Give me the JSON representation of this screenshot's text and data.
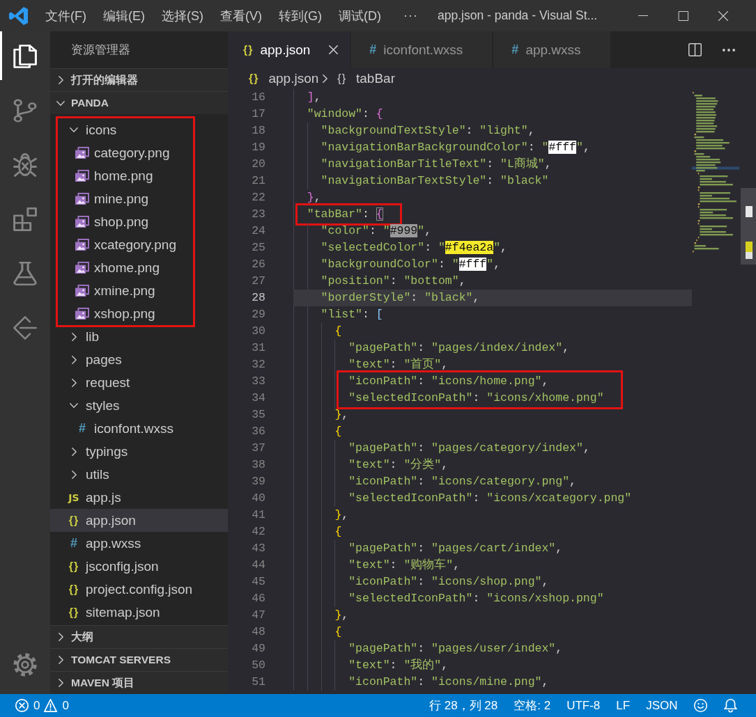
{
  "title_bar": {
    "menus": [
      "文件(F)",
      "编辑(E)",
      "选择(S)",
      "查看(V)",
      "转到(G)",
      "调试(D)"
    ],
    "overflow": "···",
    "title": "app.json - panda - Visual St..."
  },
  "activity_bar": {
    "items": [
      {
        "kind": "files",
        "selected": true
      },
      {
        "kind": "source-control",
        "selected": false
      },
      {
        "kind": "debug",
        "selected": false
      },
      {
        "kind": "extensions",
        "selected": false
      },
      {
        "kind": "testing",
        "selected": false
      },
      {
        "kind": "diamond",
        "selected": false
      }
    ]
  },
  "sidebar": {
    "title": "资源管理器",
    "sections": [
      {
        "label": "打开的编辑器",
        "expanded": false
      },
      {
        "label": "PANDA",
        "expanded": true,
        "tree": [
          {
            "kind": "folder",
            "label": "icons",
            "expanded": true,
            "selected": false,
            "marked": true,
            "children": [
              {
                "kind": "image",
                "label": "category.png",
                "selected": false
              },
              {
                "kind": "image",
                "label": "home.png",
                "selected": false
              },
              {
                "kind": "image",
                "label": "mine.png",
                "selected": false
              },
              {
                "kind": "image",
                "label": "shop.png",
                "selected": false
              },
              {
                "kind": "image",
                "label": "xcategory.png",
                "selected": false
              },
              {
                "kind": "image",
                "label": "xhome.png",
                "selected": false
              },
              {
                "kind": "image",
                "label": "xmine.png",
                "selected": false
              },
              {
                "kind": "image",
                "label": "xshop.png",
                "selected": false
              }
            ]
          },
          {
            "kind": "folder",
            "label": "lib",
            "expanded": false,
            "selected": false,
            "marked": false
          },
          {
            "kind": "folder",
            "label": "pages",
            "expanded": false,
            "selected": false,
            "marked": false
          },
          {
            "kind": "folder",
            "label": "request",
            "expanded": false,
            "selected": false,
            "marked": false
          },
          {
            "kind": "folder",
            "label": "styles",
            "expanded": true,
            "selected": false,
            "marked": false,
            "children": [
              {
                "kind": "css",
                "icon": "#",
                "label": "iconfont.wxss",
                "selected": false
              }
            ]
          },
          {
            "kind": "folder",
            "label": "typings",
            "expanded": false,
            "selected": false,
            "marked": false
          },
          {
            "kind": "folder",
            "label": "utils",
            "expanded": false,
            "selected": false,
            "marked": false
          },
          {
            "kind": "js",
            "icon": "JS",
            "label": "app.js",
            "selected": false,
            "marked": false
          },
          {
            "kind": "json",
            "icon": "{}",
            "label": "app.json",
            "selected": true,
            "marked": false
          },
          {
            "kind": "css",
            "icon": "#",
            "label": "app.wxss",
            "selected": false,
            "marked": false
          },
          {
            "kind": "json",
            "icon": "{}",
            "label": "jsconfig.json",
            "selected": false,
            "marked": false
          },
          {
            "kind": "json",
            "icon": "{}",
            "label": "project.config.json",
            "selected": false,
            "marked": false
          },
          {
            "kind": "json",
            "icon": "{}",
            "label": "sitemap.json",
            "selected": false,
            "marked": false
          }
        ]
      },
      {
        "label": "大纲",
        "expanded": false
      },
      {
        "label": "TOMCAT SERVERS",
        "expanded": false
      },
      {
        "label": "MAVEN 项目",
        "expanded": false
      }
    ]
  },
  "editor": {
    "tabs": [
      {
        "kind": "json",
        "icon": "{}",
        "label": "app.json",
        "selected": true
      },
      {
        "kind": "css",
        "icon": "#",
        "label": "iconfont.wxss",
        "selected": false
      },
      {
        "kind": "css",
        "icon": "#",
        "label": "app.wxss",
        "selected": false
      }
    ],
    "breadcrumb": [
      {
        "kind": "json",
        "icon": "{}",
        "label": "app.json"
      },
      {
        "kind": "object",
        "icon": "{}",
        "label": "tabBar"
      }
    ],
    "lines": [
      {
        "number": "16",
        "current": false,
        "marked": false,
        "tokens": [
          {
            "kind": "bracket",
            "text": "]",
            "color": "#da70d6"
          },
          {
            "kind": "punct",
            "text": ","
          }
        ]
      },
      {
        "number": "17",
        "current": false,
        "marked": false,
        "tokens": [
          {
            "kind": "str",
            "text": "\"window\""
          },
          {
            "kind": "punct",
            "text": ": "
          },
          {
            "kind": "bracket",
            "text": "{",
            "color": "#da70d6"
          }
        ],
        "children": [
          {
            "number": "18",
            "current": false,
            "marked": false,
            "tokens": [
              {
                "kind": "str",
                "text": "\"backgroundTextStyle\""
              },
              {
                "kind": "punct",
                "text": ": "
              },
              {
                "kind": "str",
                "text": "\"light\""
              },
              {
                "kind": "punct",
                "text": ","
              }
            ]
          },
          {
            "number": "19",
            "current": false,
            "marked": false,
            "tokens": [
              {
                "kind": "str",
                "text": "\"navigationBarBackgroundColor\""
              },
              {
                "kind": "punct",
                "text": ": "
              },
              {
                "kind": "str",
                "text": "\""
              },
              {
                "kind": "swatch",
                "text": "#fff",
                "color": "#ffffff"
              },
              {
                "kind": "str",
                "text": "\""
              },
              {
                "kind": "punct",
                "text": ","
              }
            ]
          },
          {
            "number": "20",
            "current": false,
            "marked": false,
            "tokens": [
              {
                "kind": "str",
                "text": "\"navigationBarTitleText\""
              },
              {
                "kind": "punct",
                "text": ": "
              },
              {
                "kind": "str",
                "text": "\"L商城\""
              },
              {
                "kind": "punct",
                "text": ","
              }
            ]
          },
          {
            "number": "21",
            "current": false,
            "marked": false,
            "tokens": [
              {
                "kind": "str",
                "text": "\"navigationBarTextStyle\""
              },
              {
                "kind": "punct",
                "text": ": "
              },
              {
                "kind": "str",
                "text": "\"black\""
              }
            ]
          }
        ]
      },
      {
        "number": "22",
        "current": false,
        "marked": false,
        "tokens": [
          {
            "kind": "bracket",
            "text": "}",
            "color": "#da70d6"
          },
          {
            "kind": "punct",
            "text": ","
          }
        ]
      },
      {
        "number": "23",
        "current": false,
        "marked": true,
        "tokens": [
          {
            "kind": "str",
            "text": "\"tabBar\""
          },
          {
            "kind": "punct",
            "text": ": "
          },
          {
            "kind": "matched-bracket",
            "text": "{",
            "color": "#da70d6"
          }
        ],
        "children": [
          {
            "number": "24",
            "current": false,
            "marked": false,
            "tokens": [
              {
                "kind": "str",
                "text": "\"color\""
              },
              {
                "kind": "punct",
                "text": ": "
              },
              {
                "kind": "str",
                "text": "\""
              },
              {
                "kind": "swatch",
                "text": "#999",
                "color": "#999999"
              },
              {
                "kind": "str",
                "text": "\""
              },
              {
                "kind": "punct",
                "text": ","
              }
            ]
          },
          {
            "number": "25",
            "current": false,
            "marked": false,
            "tokens": [
              {
                "kind": "str",
                "text": "\"selectedColor\""
              },
              {
                "kind": "punct",
                "text": ": "
              },
              {
                "kind": "str",
                "text": "\""
              },
              {
                "kind": "swatch",
                "text": "#f4ea2a",
                "color": "#f4ea2a"
              },
              {
                "kind": "str",
                "text": "\""
              },
              {
                "kind": "punct",
                "text": ","
              }
            ]
          },
          {
            "number": "26",
            "current": false,
            "marked": false,
            "tokens": [
              {
                "kind": "str",
                "text": "\"backgroundColor\""
              },
              {
                "kind": "punct",
                "text": ": "
              },
              {
                "kind": "str",
                "text": "\""
              },
              {
                "kind": "swatch",
                "text": "#fff",
                "color": "#ffffff"
              },
              {
                "kind": "str",
                "text": "\""
              },
              {
                "kind": "punct",
                "text": ","
              }
            ]
          },
          {
            "number": "27",
            "current": false,
            "marked": false,
            "tokens": [
              {
                "kind": "str",
                "text": "\"position\""
              },
              {
                "kind": "punct",
                "text": ": "
              },
              {
                "kind": "str",
                "text": "\"bottom\""
              },
              {
                "kind": "punct",
                "text": ","
              }
            ]
          },
          {
            "number": "28",
            "current": true,
            "marked": false,
            "tokens": [
              {
                "kind": "str",
                "text": "\"borderStyle\""
              },
              {
                "kind": "punct",
                "text": ": "
              },
              {
                "kind": "str",
                "text": "\"black\""
              },
              {
                "kind": "punct",
                "text": ","
              }
            ]
          },
          {
            "number": "29",
            "current": false,
            "marked": false,
            "tokens": [
              {
                "kind": "str",
                "text": "\"list\""
              },
              {
                "kind": "punct",
                "text": ": "
              },
              {
                "kind": "bracket",
                "text": "[",
                "color": "#87cefa"
              }
            ],
            "children": [
              {
                "number": "30",
                "current": false,
                "marked": false,
                "tokens": [
                  {
                    "kind": "bracket",
                    "text": "{",
                    "color": "#ffd700"
                  }
                ],
                "children": [
                  {
                    "number": "31",
                    "current": false,
                    "marked": false,
                    "tokens": [
                      {
                        "kind": "str",
                        "text": "\"pagePath\""
                      },
                      {
                        "kind": "punct",
                        "text": ": "
                      },
                      {
                        "kind": "str",
                        "text": "\"pages/index/index\""
                      },
                      {
                        "kind": "punct",
                        "text": ","
                      }
                    ]
                  },
                  {
                    "number": "32",
                    "current": false,
                    "marked": false,
                    "tokens": [
                      {
                        "kind": "str",
                        "text": "\"text\""
                      },
                      {
                        "kind": "punct",
                        "text": ": "
                      },
                      {
                        "kind": "str",
                        "text": "\"首页\""
                      },
                      {
                        "kind": "punct",
                        "text": ","
                      }
                    ]
                  },
                  {
                    "number": "33",
                    "current": false,
                    "marked": true,
                    "tokens": [
                      {
                        "kind": "str",
                        "text": "\"iconPath\""
                      },
                      {
                        "kind": "punct",
                        "text": ": "
                      },
                      {
                        "kind": "str",
                        "text": "\"icons/home.png\""
                      },
                      {
                        "kind": "punct",
                        "text": ","
                      }
                    ]
                  },
                  {
                    "number": "34",
                    "current": false,
                    "marked": true,
                    "tokens": [
                      {
                        "kind": "str",
                        "text": "\"selectedIconPath\""
                      },
                      {
                        "kind": "punct",
                        "text": ": "
                      },
                      {
                        "kind": "str",
                        "text": "\"icons/xhome.png\""
                      }
                    ]
                  }
                ]
              },
              {
                "number": "35",
                "current": false,
                "marked": false,
                "tokens": [
                  {
                    "kind": "bracket",
                    "text": "}",
                    "color": "#ffd700"
                  },
                  {
                    "kind": "punct",
                    "text": ","
                  }
                ]
              },
              {
                "number": "36",
                "current": false,
                "marked": false,
                "tokens": [
                  {
                    "kind": "bracket",
                    "text": "{",
                    "color": "#ffd700"
                  }
                ],
                "children": [
                  {
                    "number": "37",
                    "current": false,
                    "marked": false,
                    "tokens": [
                      {
                        "kind": "str",
                        "text": "\"pagePath\""
                      },
                      {
                        "kind": "punct",
                        "text": ": "
                      },
                      {
                        "kind": "str",
                        "text": "\"pages/category/index\""
                      },
                      {
                        "kind": "punct",
                        "text": ","
                      }
                    ]
                  },
                  {
                    "number": "38",
                    "current": false,
                    "marked": false,
                    "tokens": [
                      {
                        "kind": "str",
                        "text": "\"text\""
                      },
                      {
                        "kind": "punct",
                        "text": ": "
                      },
                      {
                        "kind": "str",
                        "text": "\"分类\""
                      },
                      {
                        "kind": "punct",
                        "text": ","
                      }
                    ]
                  },
                  {
                    "number": "39",
                    "current": false,
                    "marked": false,
                    "tokens": [
                      {
                        "kind": "str",
                        "text": "\"iconPath\""
                      },
                      {
                        "kind": "punct",
                        "text": ": "
                      },
                      {
                        "kind": "str",
                        "text": "\"icons/category.png\""
                      },
                      {
                        "kind": "punct",
                        "text": ","
                      }
                    ]
                  },
                  {
                    "number": "40",
                    "current": false,
                    "marked": false,
                    "tokens": [
                      {
                        "kind": "str",
                        "text": "\"selectedIconPath\""
                      },
                      {
                        "kind": "punct",
                        "text": ": "
                      },
                      {
                        "kind": "str",
                        "text": "\"icons/xcategory.png\""
                      }
                    ]
                  }
                ]
              },
              {
                "number": "41",
                "current": false,
                "marked": false,
                "tokens": [
                  {
                    "kind": "bracket",
                    "text": "}",
                    "color": "#ffd700"
                  },
                  {
                    "kind": "punct",
                    "text": ","
                  }
                ]
              },
              {
                "number": "42",
                "current": false,
                "marked": false,
                "tokens": [
                  {
                    "kind": "bracket",
                    "text": "{",
                    "color": "#ffd700"
                  }
                ],
                "children": [
                  {
                    "number": "43",
                    "current": false,
                    "marked": false,
                    "tokens": [
                      {
                        "kind": "str",
                        "text": "\"pagePath\""
                      },
                      {
                        "kind": "punct",
                        "text": ": "
                      },
                      {
                        "kind": "str",
                        "text": "\"pages/cart/index\""
                      },
                      {
                        "kind": "punct",
                        "text": ","
                      }
                    ]
                  },
                  {
                    "number": "44",
                    "current": false,
                    "marked": false,
                    "tokens": [
                      {
                        "kind": "str",
                        "text": "\"text\""
                      },
                      {
                        "kind": "punct",
                        "text": ": "
                      },
                      {
                        "kind": "str",
                        "text": "\"购物车\""
                      },
                      {
                        "kind": "punct",
                        "text": ","
                      }
                    ]
                  },
                  {
                    "number": "45",
                    "current": false,
                    "marked": false,
                    "tokens": [
                      {
                        "kind": "str",
                        "text": "\"iconPath\""
                      },
                      {
                        "kind": "punct",
                        "text": ": "
                      },
                      {
                        "kind": "str",
                        "text": "\"icons/shop.png\""
                      },
                      {
                        "kind": "punct",
                        "text": ","
                      }
                    ]
                  },
                  {
                    "number": "46",
                    "current": false,
                    "marked": false,
                    "tokens": [
                      {
                        "kind": "str",
                        "text": "\"selectedIconPath\""
                      },
                      {
                        "kind": "punct",
                        "text": ": "
                      },
                      {
                        "kind": "str",
                        "text": "\"icons/xshop.png\""
                      }
                    ]
                  }
                ]
              },
              {
                "number": "47",
                "current": false,
                "marked": false,
                "tokens": [
                  {
                    "kind": "bracket",
                    "text": "}",
                    "color": "#ffd700"
                  },
                  {
                    "kind": "punct",
                    "text": ","
                  }
                ]
              },
              {
                "number": "48",
                "current": false,
                "marked": false,
                "tokens": [
                  {
                    "kind": "bracket",
                    "text": "{",
                    "color": "#ffd700"
                  }
                ],
                "children": [
                  {
                    "number": "49",
                    "current": false,
                    "marked": false,
                    "tokens": [
                      {
                        "kind": "str",
                        "text": "\"pagePath\""
                      },
                      {
                        "kind": "punct",
                        "text": ": "
                      },
                      {
                        "kind": "str",
                        "text": "\"pages/user/index\""
                      },
                      {
                        "kind": "punct",
                        "text": ","
                      }
                    ]
                  },
                  {
                    "number": "50",
                    "current": false,
                    "marked": false,
                    "tokens": [
                      {
                        "kind": "str",
                        "text": "\"text\""
                      },
                      {
                        "kind": "punct",
                        "text": ": "
                      },
                      {
                        "kind": "str",
                        "text": "\"我的\""
                      },
                      {
                        "kind": "punct",
                        "text": ","
                      }
                    ]
                  },
                  {
                    "number": "51",
                    "current": false,
                    "marked": false,
                    "tokens": [
                      {
                        "kind": "str",
                        "text": "\"iconPath\""
                      },
                      {
                        "kind": "punct",
                        "text": ": "
                      },
                      {
                        "kind": "str",
                        "text": "\"icons/mine.png\""
                      },
                      {
                        "kind": "punct",
                        "text": ","
                      }
                    ]
                  }
                ]
              }
            ]
          }
        ]
      }
    ]
  },
  "status_bar": {
    "errors": "0",
    "warnings": "0",
    "items": [
      "行 28，列 28",
      "空格: 2",
      "UTF-8",
      "LF",
      "JSON"
    ]
  }
}
